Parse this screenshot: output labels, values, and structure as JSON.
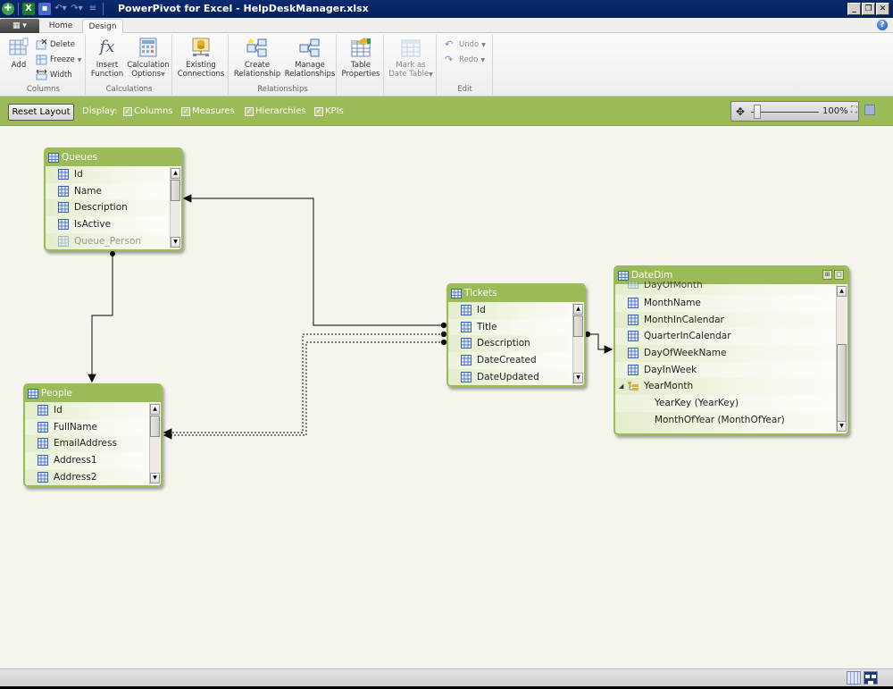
{
  "window": {
    "title": "PowerPivot for Excel - HelpDeskManager.xlsx",
    "controls": [
      "minimize",
      "restore",
      "close"
    ]
  },
  "quick_access": [
    "app-icon",
    "excel-icon",
    "save-icon",
    "undo-icon",
    "redo-icon",
    "customize-icon"
  ],
  "tabs": [
    {
      "label": "Home",
      "active": false
    },
    {
      "label": "Design",
      "active": true
    }
  ],
  "ribbon": {
    "groups": [
      {
        "label": "Columns",
        "buttons": [
          {
            "label": "Add",
            "icon": "add-column-icon",
            "enabled": true
          },
          {
            "label": "Delete",
            "icon": "delete-column-icon",
            "enabled": true
          },
          {
            "label": "Freeze",
            "icon": "freeze-icon",
            "enabled": true,
            "dropdown": true
          },
          {
            "label": "Width",
            "icon": "width-icon",
            "enabled": true
          }
        ]
      },
      {
        "label": "Calculations",
        "buttons": [
          {
            "label": "Insert Function",
            "icon": "fx-icon",
            "enabled": true
          },
          {
            "label": "Calculation Options",
            "icon": "calculator-icon",
            "enabled": true,
            "dropdown": true
          }
        ]
      },
      {
        "label": "",
        "buttons": [
          {
            "label": "Existing Connections",
            "icon": "database-icon",
            "enabled": true
          }
        ]
      },
      {
        "label": "Relationships",
        "buttons": [
          {
            "label": "Create Relationship",
            "icon": "create-relationship-icon",
            "enabled": true
          },
          {
            "label": "Manage Relationships",
            "icon": "manage-relationships-icon",
            "enabled": true
          }
        ]
      },
      {
        "label": "",
        "buttons": [
          {
            "label": "Table Properties",
            "icon": "table-properties-icon",
            "enabled": true
          }
        ]
      },
      {
        "label": "",
        "buttons": [
          {
            "label": "Mark as Date Table",
            "icon": "calendar-icon",
            "enabled": false,
            "dropdown": true
          }
        ]
      },
      {
        "label": "Edit",
        "buttons": [
          {
            "label": "Undo",
            "icon": "undo-icon",
            "enabled": false,
            "dropdown": true
          },
          {
            "label": "Redo",
            "icon": "redo-icon",
            "enabled": false,
            "dropdown": true
          }
        ]
      }
    ]
  },
  "toolbar": {
    "reset_label": "Reset Layout",
    "display_label": "Display:",
    "checkboxes": [
      {
        "label": "Columns",
        "checked": true
      },
      {
        "label": "Measures",
        "checked": true
      },
      {
        "label": "Hierarchies",
        "checked": true
      },
      {
        "label": "KPIs",
        "checked": true
      }
    ],
    "zoom": "100%"
  },
  "tables": [
    {
      "name": "Queues",
      "rows": [
        "Id",
        "Name",
        "Description",
        "IsActive",
        "Queue_Person"
      ]
    },
    {
      "name": "People",
      "rows": [
        "Id",
        "FullName",
        "EmailAddress",
        "Address1",
        "Address2"
      ]
    },
    {
      "name": "Tickets",
      "rows": [
        "Id",
        "Title",
        "Description",
        "DateCreated",
        "DateUpdated"
      ]
    },
    {
      "name": "DateDim",
      "rows": [
        "DayOfMonth",
        "MonthName",
        "MonthInCalendar",
        "QuarterInCalendar",
        "DayOfWeekName",
        "DayInWeek"
      ],
      "hierarchy": {
        "name": "YearMonth",
        "levels": [
          "YearKey (YearKey)",
          "MonthOfYear (MonthOfYear)"
        ]
      }
    }
  ],
  "relationships": [
    {
      "from": "Queues",
      "to": "People",
      "active": true
    },
    {
      "from": "Tickets",
      "to": "Queues",
      "active": true
    },
    {
      "from": "Tickets",
      "to": "People",
      "active": false
    },
    {
      "from": "Tickets",
      "to": "People",
      "active": false
    },
    {
      "from": "Tickets",
      "to": "DateDim",
      "active": true
    }
  ],
  "colors": {
    "accent_green": "#9bbb59",
    "title_bar": "#0a2a6e",
    "canvas": "#f5f5ee"
  },
  "statusbar": {
    "views": [
      {
        "name": "data-view",
        "active": false
      },
      {
        "name": "diagram-view",
        "active": true
      }
    ]
  }
}
